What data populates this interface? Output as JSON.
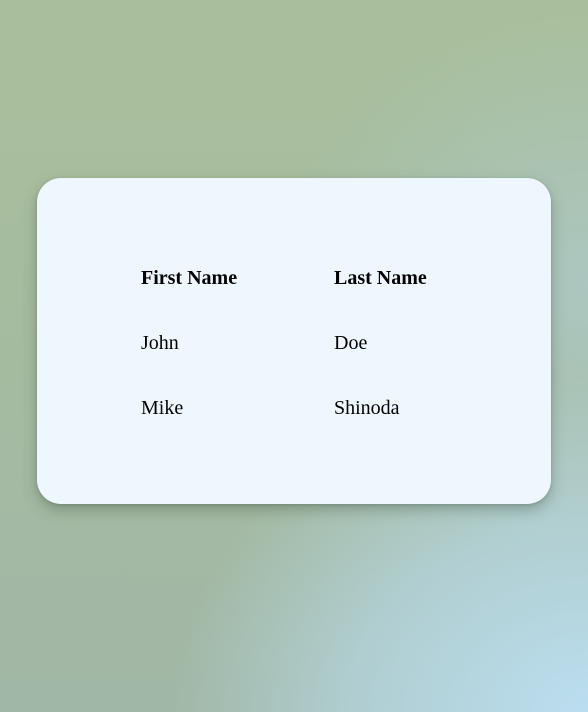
{
  "table": {
    "headers": [
      "First Name",
      "Last Name"
    ],
    "rows": [
      [
        "John",
        "Doe"
      ],
      [
        "Mike",
        "Shinoda"
      ]
    ]
  },
  "colors": {
    "card_background": "#eef7fd",
    "text": "#000000"
  }
}
